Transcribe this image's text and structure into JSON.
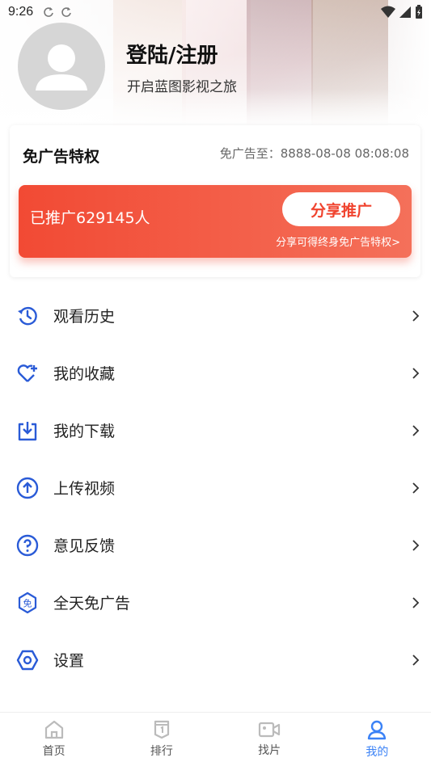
{
  "status_bar": {
    "time": "9:26"
  },
  "profile": {
    "title": "登陆/注册",
    "subtitle": "开启蓝图影视之旅"
  },
  "ad_free_card": {
    "title": "免广告特权",
    "expire_text": "免广告至：8888-08-08 08:08:08",
    "promoted_text": "已推广629145人",
    "share_button": "分享推广",
    "hint": "分享可得终身免广告特权>"
  },
  "menu": [
    {
      "label": "观看历史",
      "icon": "history-icon"
    },
    {
      "label": "我的收藏",
      "icon": "heart-plus-icon"
    },
    {
      "label": "我的下载",
      "icon": "download-icon"
    },
    {
      "label": "上传视频",
      "icon": "upload-icon"
    },
    {
      "label": "意见反馈",
      "icon": "help-icon"
    },
    {
      "label": "全天免广告",
      "icon": "ad-free-icon"
    },
    {
      "label": "设置",
      "icon": "settings-icon"
    }
  ],
  "bottom_nav": [
    {
      "label": "首页",
      "icon": "home-icon",
      "active": false
    },
    {
      "label": "排行",
      "icon": "ranking-icon",
      "active": false
    },
    {
      "label": "找片",
      "icon": "video-icon",
      "active": false
    },
    {
      "label": "我的",
      "icon": "user-icon",
      "active": true
    }
  ],
  "colors": {
    "accent": "#3b82f6",
    "promo_start": "#f24a34",
    "promo_end": "#f4705a"
  }
}
